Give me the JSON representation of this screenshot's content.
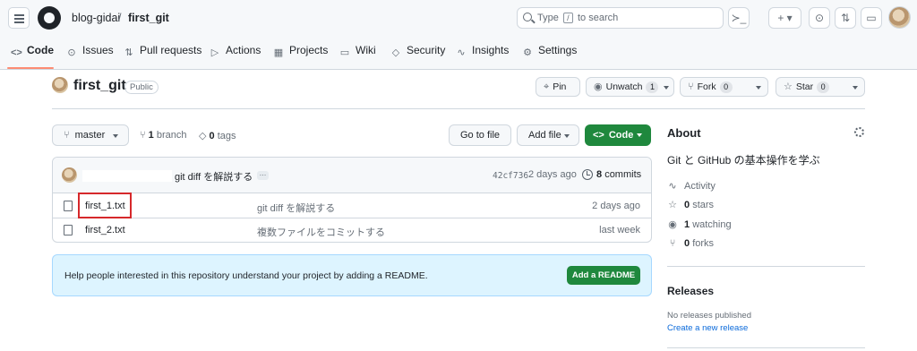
{
  "header": {
    "owner": "blog-gidai",
    "separator": "/",
    "repo": "first_git",
    "search_before": "Type",
    "search_key": "/",
    "search_after": "to search",
    "terminal_glyph": "≻_",
    "plus_glyph": "+ ▾",
    "issues_glyph": "⊙",
    "pulls_glyph": "⇅",
    "inbox_glyph": "▭"
  },
  "tabs": [
    {
      "label": "Code",
      "icon": "code-icon",
      "glyph": "<>"
    },
    {
      "label": "Issues",
      "icon": "issue-icon",
      "glyph": "⊙"
    },
    {
      "label": "Pull requests",
      "icon": "pull-request-icon",
      "glyph": "⇅"
    },
    {
      "label": "Actions",
      "icon": "play-icon",
      "glyph": "▷"
    },
    {
      "label": "Projects",
      "icon": "table-icon",
      "glyph": "▦"
    },
    {
      "label": "Wiki",
      "icon": "book-icon",
      "glyph": "▭"
    },
    {
      "label": "Security",
      "icon": "shield-icon",
      "glyph": "◇"
    },
    {
      "label": "Insights",
      "icon": "graph-icon",
      "glyph": "∿"
    },
    {
      "label": "Settings",
      "icon": "gear-icon",
      "glyph": "⚙"
    }
  ],
  "repo": {
    "name": "first_git",
    "visibility": "Public",
    "pin_label": "Pin",
    "watch_label": "Unwatch",
    "watch_count": "1",
    "fork_label": "Fork",
    "fork_count": "0",
    "star_label": "Star",
    "star_count": "0"
  },
  "toolbar": {
    "branch_name": "master",
    "branch_count": "1",
    "branch_word": "branch",
    "tag_count": "0",
    "tag_word": "tags",
    "go_to_file": "Go to file",
    "add_file": "Add file",
    "code_label": "Code"
  },
  "commit": {
    "message": "git diff を解説する",
    "ellipsis": "…",
    "sha": "42cf736",
    "time": "2 days ago",
    "count": "8",
    "count_word": "commits"
  },
  "files": [
    {
      "name": "first_1.txt",
      "message": "git diff を解説する",
      "time": "2 days ago"
    },
    {
      "name": "first_2.txt",
      "message": "複数ファイルをコミットする",
      "time": "last week"
    }
  ],
  "readme": {
    "text": "Help people interested in this repository understand your project by adding a README.",
    "button": "Add a README"
  },
  "about": {
    "title": "About",
    "description": "Git と GitHub の基本操作を学ぶ",
    "activity": "Activity",
    "stars_count": "0",
    "stars_word": "stars",
    "watching_count": "1",
    "watching_word": "watching",
    "forks_count": "0",
    "forks_word": "forks"
  },
  "releases": {
    "title": "Releases",
    "none": "No releases published",
    "create": "Create a new release"
  },
  "colors": {
    "accent_green": "#1f883d",
    "tab_underline": "#fd8c73",
    "highlight_red": "#d6282b",
    "banner_blue": "#ddf4ff",
    "link_blue": "#0969da"
  }
}
